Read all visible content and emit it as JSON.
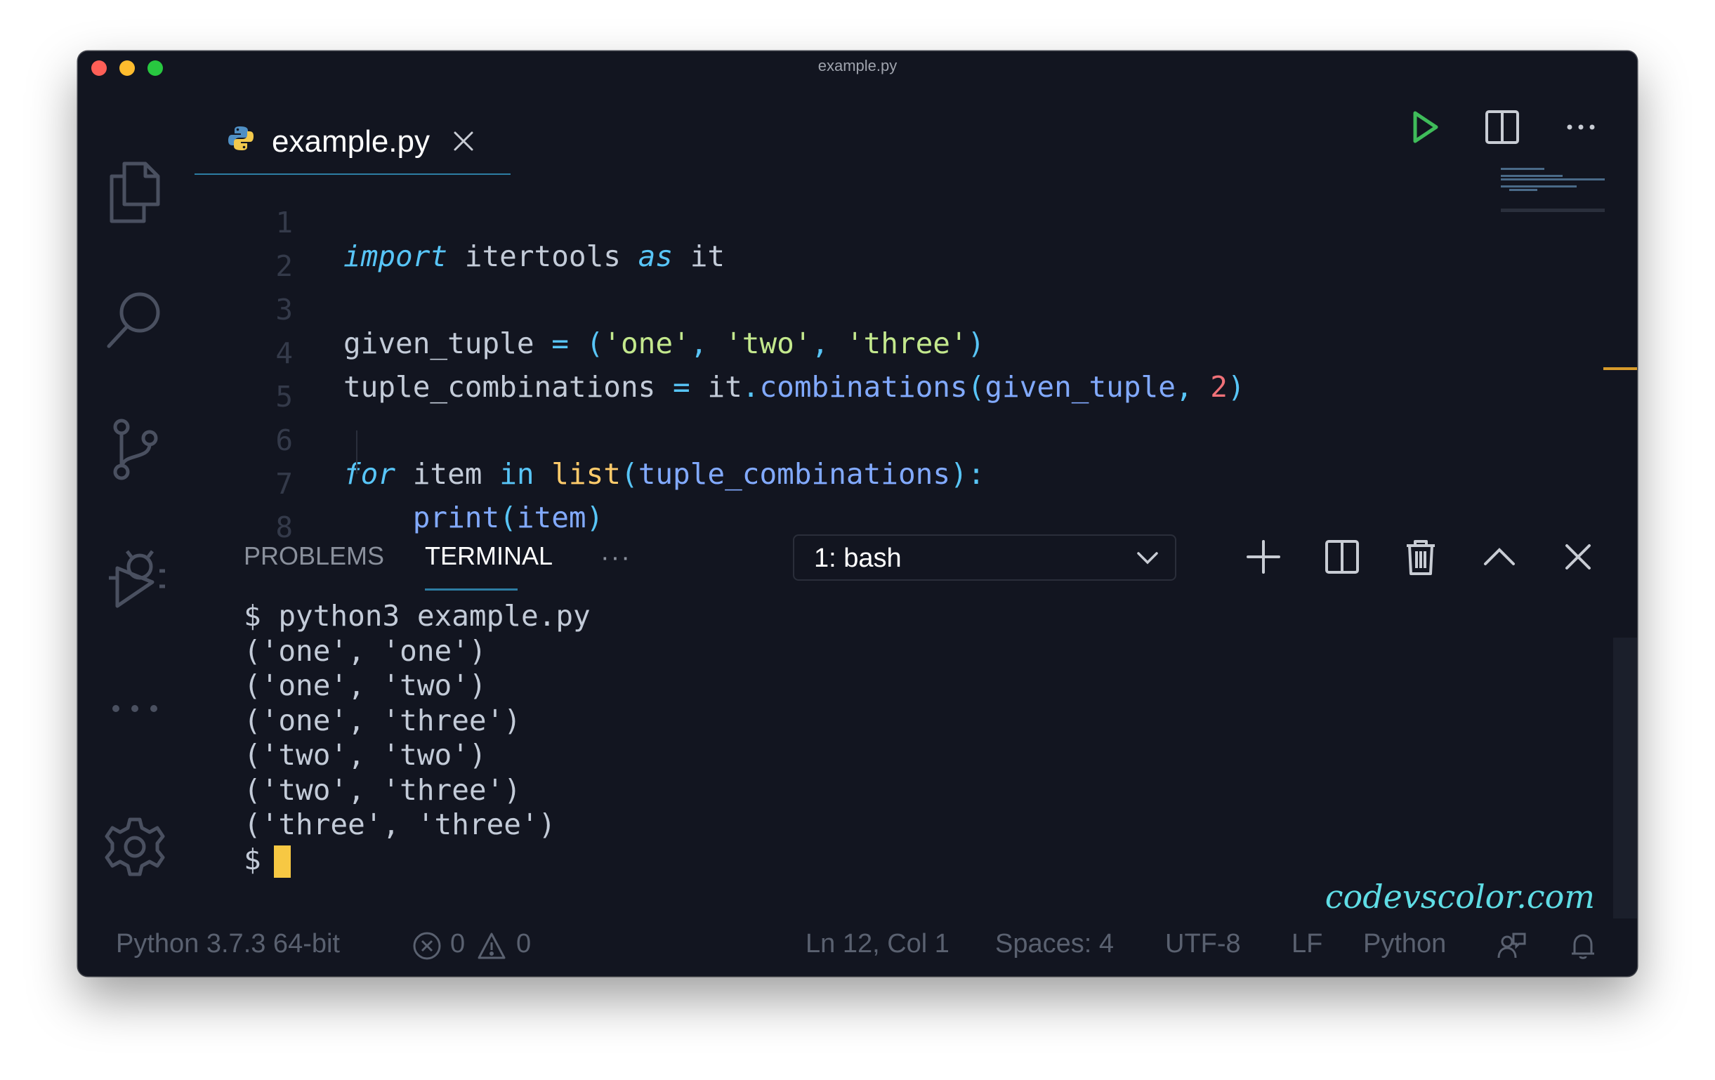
{
  "window": {
    "title": "example.py"
  },
  "tab": {
    "label": "example.py"
  },
  "editor": {
    "line_numbers": [
      "1",
      "2",
      "3",
      "4",
      "5",
      "6",
      "7",
      "8"
    ]
  },
  "code_tokens": {
    "l1": [
      "import",
      "itertools",
      "as",
      "it"
    ],
    "l3": [
      "given_tuple",
      "=",
      "(",
      "'one'",
      ",",
      "'two'",
      ",",
      "'three'",
      ")"
    ],
    "l4": [
      "tuple_combinations",
      "=",
      "it",
      ".",
      "combinations",
      "(",
      "given_tuple",
      ",",
      "2",
      ")"
    ],
    "l6": [
      "for",
      "item",
      "in",
      "list",
      "(",
      "tuple_combinations",
      "):"
    ],
    "l7": [
      "print",
      "(",
      "item",
      ")"
    ]
  },
  "panel": {
    "tabs": [
      "PROBLEMS",
      "TERMINAL"
    ],
    "more": "···",
    "terminal_select": "1: bash"
  },
  "terminal": {
    "lines": [
      "$ python3 example.py",
      "('one', 'one')",
      "('one', 'two')",
      "('one', 'three')",
      "('two', 'two')",
      "('two', 'three')",
      "('three', 'three')"
    ],
    "prompt": "$"
  },
  "brand": "codevscolor.com",
  "status": {
    "interpreter": "Python 3.7.3 64-bit",
    "errors": "0",
    "warnings": "0",
    "position": "Ln 12, Col 1",
    "spaces": "Spaces: 4",
    "encoding": "UTF-8",
    "eol": "LF",
    "language": "Python"
  },
  "colors": {
    "background": "#121520",
    "keyword": "#58c5f7",
    "string": "#c3e88d",
    "function": "#82aaff",
    "number": "#f07178",
    "builtin": "#ffcb6b",
    "accent": "#2d7da3",
    "cursor": "#f7c843",
    "brand": "#5fdde5"
  },
  "icons": [
    "explorer-icon",
    "search-icon",
    "source-control-icon",
    "debug-icon",
    "more-icon",
    "settings-icon",
    "python-file-icon",
    "close-icon",
    "run-icon",
    "split-editor-icon",
    "more-actions-icon",
    "add-terminal-icon",
    "split-terminal-icon",
    "trash-icon",
    "maximize-panel-icon",
    "close-panel-icon",
    "error-icon",
    "warning-icon",
    "feedback-icon",
    "bell-icon"
  ]
}
